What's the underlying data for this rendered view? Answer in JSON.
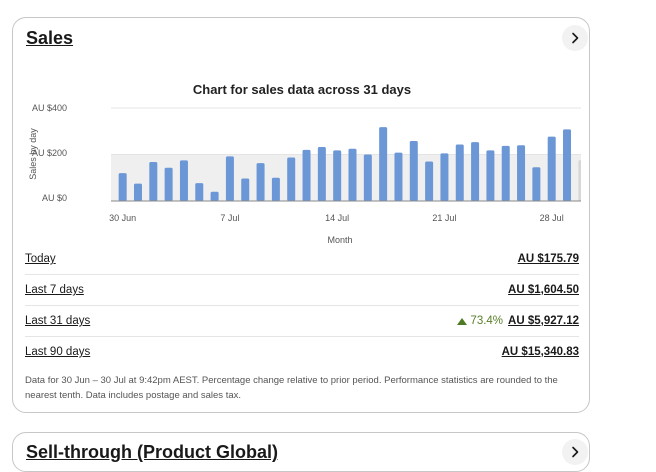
{
  "card": {
    "title": "Sales",
    "chart": {
      "title": "Chart for sales data across 31 days",
      "ylabel": "Sales by day",
      "xlabel": "Month",
      "yticks": [
        "AU $0",
        "AU $200",
        "AU $400"
      ],
      "xticks": [
        "30 Jun",
        "7 Jul",
        "14 Jul",
        "21 Jul",
        "28 Jul"
      ]
    },
    "rows": [
      {
        "label": "Today",
        "value": "AU $175.79",
        "change": ""
      },
      {
        "label": "Last 7 days",
        "value": "AU $1,604.50",
        "change": ""
      },
      {
        "label": "Last 31 days",
        "value": "AU $5,927.12",
        "change": "73.4%"
      },
      {
        "label": "Last 90 days",
        "value": "AU $15,340.83",
        "change": ""
      }
    ],
    "footnote": "Data for 30 Jun – 30 Jul at 9:42pm AEST. Percentage change relative to prior period. Performance statistics are rounded to the nearest tenth. Data includes postage and sales tax."
  },
  "next_card": {
    "title": "Sell-through (Product Global)"
  },
  "colors": {
    "bar": "#6b97d6",
    "bar_current": "#d7d7d7",
    "band": "#efefef",
    "positive": "#4e7a24"
  },
  "icons": {
    "open": "chevron-right-icon",
    "up": "triangle-up-icon"
  },
  "chart_data": {
    "type": "bar",
    "title": "Chart for sales data across 31 days",
    "xlabel": "Month",
    "ylabel": "Sales by day",
    "ylim": [
      0,
      400
    ],
    "yticks": [
      "AU $0",
      "AU $200",
      "AU $400"
    ],
    "tick_labels": [
      "30 Jun",
      "7 Jul",
      "14 Jul",
      "21 Jul",
      "28 Jul"
    ],
    "categories": [
      "30 Jun",
      "1 Jul",
      "2 Jul",
      "3 Jul",
      "4 Jul",
      "5 Jul",
      "6 Jul",
      "7 Jul",
      "8 Jul",
      "9 Jul",
      "10 Jul",
      "11 Jul",
      "12 Jul",
      "13 Jul",
      "14 Jul",
      "15 Jul",
      "16 Jul",
      "17 Jul",
      "18 Jul",
      "19 Jul",
      "20 Jul",
      "21 Jul",
      "22 Jul",
      "23 Jul",
      "24 Jul",
      "25 Jul",
      "26 Jul",
      "27 Jul",
      "28 Jul",
      "29 Jul",
      "30 Jul"
    ],
    "values": [
      120,
      75,
      168,
      143,
      175,
      77,
      40,
      192,
      97,
      163,
      100,
      187,
      220,
      232,
      218,
      225,
      200,
      318,
      208,
      258,
      170,
      205,
      243,
      253,
      218,
      237,
      240,
      145,
      277,
      308,
      176
    ],
    "current_day_index": 30
  }
}
